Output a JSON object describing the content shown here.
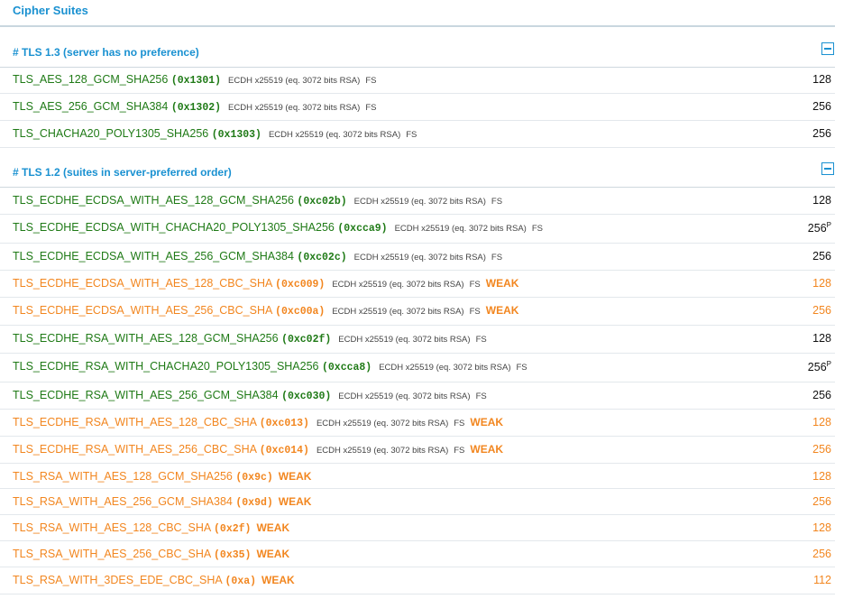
{
  "page": {
    "title": "Cipher Suites"
  },
  "sections": [
    {
      "header": "# TLS 1.3 (server has no preference)",
      "rows": [
        {
          "name": "TLS_AES_128_GCM_SHA256",
          "code": "(0x1301)",
          "info": "ECDH x25519 (eq. 3072 bits RSA)",
          "fs": "FS",
          "weak": "",
          "bits": "128",
          "sup": "",
          "status": "strong"
        },
        {
          "name": "TLS_AES_256_GCM_SHA384",
          "code": "(0x1302)",
          "info": "ECDH x25519 (eq. 3072 bits RSA)",
          "fs": "FS",
          "weak": "",
          "bits": "256",
          "sup": "",
          "status": "strong"
        },
        {
          "name": "TLS_CHACHA20_POLY1305_SHA256",
          "code": "(0x1303)",
          "info": "ECDH x25519 (eq. 3072 bits RSA)",
          "fs": "FS",
          "weak": "",
          "bits": "256",
          "sup": "",
          "status": "strong"
        }
      ]
    },
    {
      "header": "# TLS 1.2 (suites in server-preferred order)",
      "rows": [
        {
          "name": "TLS_ECDHE_ECDSA_WITH_AES_128_GCM_SHA256",
          "code": "(0xc02b)",
          "info": "ECDH x25519 (eq. 3072 bits RSA)",
          "fs": "FS",
          "weak": "",
          "bits": "128",
          "sup": "",
          "status": "strong"
        },
        {
          "name": "TLS_ECDHE_ECDSA_WITH_CHACHA20_POLY1305_SHA256",
          "code": "(0xcca9)",
          "info": "ECDH x25519 (eq. 3072 bits RSA)",
          "fs": "FS",
          "weak": "",
          "bits": "256",
          "sup": "P",
          "status": "strong"
        },
        {
          "name": "TLS_ECDHE_ECDSA_WITH_AES_256_GCM_SHA384",
          "code": "(0xc02c)",
          "info": "ECDH x25519 (eq. 3072 bits RSA)",
          "fs": "FS",
          "weak": "",
          "bits": "256",
          "sup": "",
          "status": "strong"
        },
        {
          "name": "TLS_ECDHE_ECDSA_WITH_AES_128_CBC_SHA",
          "code": "(0xc009)",
          "info": "ECDH x25519 (eq. 3072 bits RSA)",
          "fs": "FS",
          "weak": "WEAK",
          "bits": "128",
          "sup": "",
          "status": "weak"
        },
        {
          "name": "TLS_ECDHE_ECDSA_WITH_AES_256_CBC_SHA",
          "code": "(0xc00a)",
          "info": "ECDH x25519 (eq. 3072 bits RSA)",
          "fs": "FS",
          "weak": "WEAK",
          "bits": "256",
          "sup": "",
          "status": "weak"
        },
        {
          "name": "TLS_ECDHE_RSA_WITH_AES_128_GCM_SHA256",
          "code": "(0xc02f)",
          "info": "ECDH x25519 (eq. 3072 bits RSA)",
          "fs": "FS",
          "weak": "",
          "bits": "128",
          "sup": "",
          "status": "strong"
        },
        {
          "name": "TLS_ECDHE_RSA_WITH_CHACHA20_POLY1305_SHA256",
          "code": "(0xcca8)",
          "info": "ECDH x25519 (eq. 3072 bits RSA)",
          "fs": "FS",
          "weak": "",
          "bits": "256",
          "sup": "P",
          "status": "strong"
        },
        {
          "name": "TLS_ECDHE_RSA_WITH_AES_256_GCM_SHA384",
          "code": "(0xc030)",
          "info": "ECDH x25519 (eq. 3072 bits RSA)",
          "fs": "FS",
          "weak": "",
          "bits": "256",
          "sup": "",
          "status": "strong"
        },
        {
          "name": "TLS_ECDHE_RSA_WITH_AES_128_CBC_SHA",
          "code": "(0xc013)",
          "info": "ECDH x25519 (eq. 3072 bits RSA)",
          "fs": "FS",
          "weak": "WEAK",
          "bits": "128",
          "sup": "",
          "status": "weak"
        },
        {
          "name": "TLS_ECDHE_RSA_WITH_AES_256_CBC_SHA",
          "code": "(0xc014)",
          "info": "ECDH x25519 (eq. 3072 bits RSA)",
          "fs": "FS",
          "weak": "WEAK",
          "bits": "256",
          "sup": "",
          "status": "weak"
        },
        {
          "name": "TLS_RSA_WITH_AES_128_GCM_SHA256",
          "code": "(0x9c)",
          "info": "",
          "fs": "",
          "weak": "WEAK",
          "bits": "128",
          "sup": "",
          "status": "weak"
        },
        {
          "name": "TLS_RSA_WITH_AES_256_GCM_SHA384",
          "code": "(0x9d)",
          "info": "",
          "fs": "",
          "weak": "WEAK",
          "bits": "256",
          "sup": "",
          "status": "weak"
        },
        {
          "name": "TLS_RSA_WITH_AES_128_CBC_SHA",
          "code": "(0x2f)",
          "info": "",
          "fs": "",
          "weak": "WEAK",
          "bits": "128",
          "sup": "",
          "status": "weak"
        },
        {
          "name": "TLS_RSA_WITH_AES_256_CBC_SHA",
          "code": "(0x35)",
          "info": "",
          "fs": "",
          "weak": "WEAK",
          "bits": "256",
          "sup": "",
          "status": "weak"
        },
        {
          "name": "TLS_RSA_WITH_3DES_EDE_CBC_SHA",
          "code": "(0xa)",
          "info": "",
          "fs": "",
          "weak": "WEAK",
          "bits": "112",
          "sup": "",
          "status": "weak"
        }
      ]
    }
  ],
  "icons": {
    "collapse": "collapse-minus-icon"
  },
  "colors": {
    "heading": "#1a91d1",
    "strong": "#1f7a16",
    "weak": "#f2861f"
  }
}
